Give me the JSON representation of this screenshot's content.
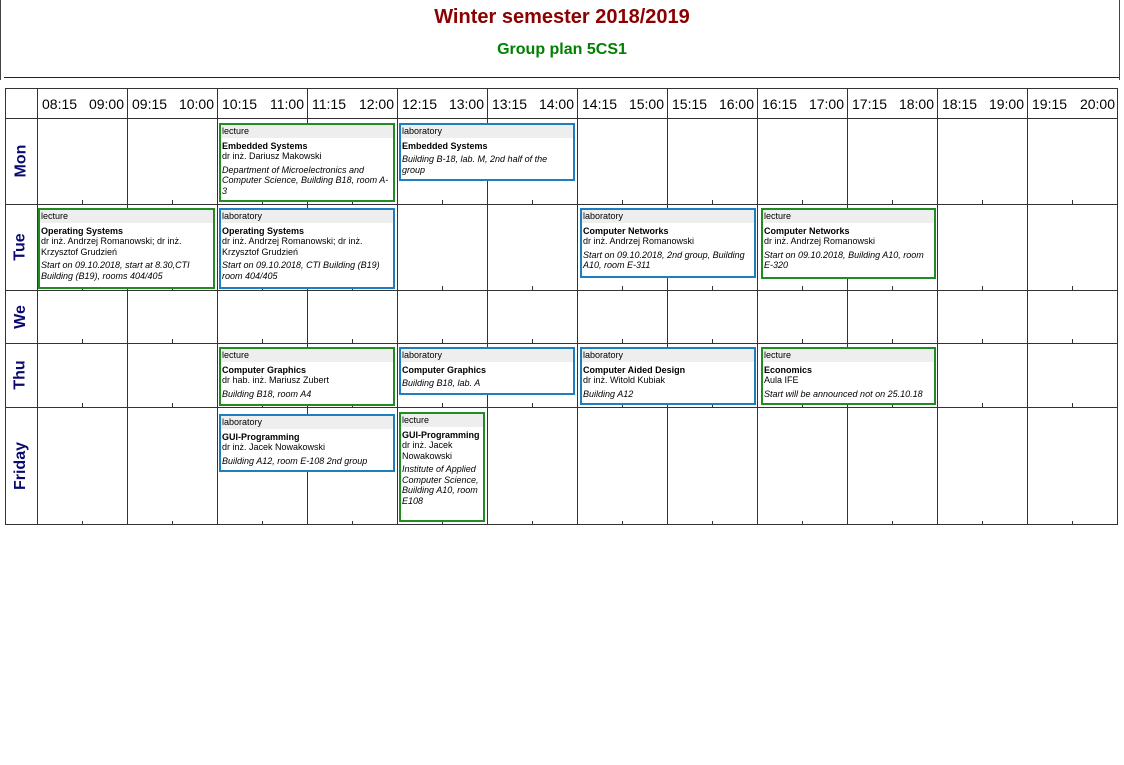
{
  "title": "Winter semester 2018/2019",
  "subtitle": "Group plan 5CS1",
  "time_columns": [
    {
      "start": "08:15",
      "end": "09:00"
    },
    {
      "start": "09:15",
      "end": "10:00"
    },
    {
      "start": "10:15",
      "end": "11:00"
    },
    {
      "start": "11:15",
      "end": "12:00"
    },
    {
      "start": "12:15",
      "end": "13:00"
    },
    {
      "start": "13:15",
      "end": "14:00"
    },
    {
      "start": "14:15",
      "end": "15:00"
    },
    {
      "start": "15:15",
      "end": "16:00"
    },
    {
      "start": "16:15",
      "end": "17:00"
    },
    {
      "start": "17:15",
      "end": "18:00"
    },
    {
      "start": "18:15",
      "end": "19:00"
    },
    {
      "start": "19:15",
      "end": "20:00"
    }
  ],
  "days": [
    "Mon",
    "Tue",
    "We",
    "Thu",
    "Friday"
  ],
  "colors": {
    "title": "#8b0000",
    "subtitle": "#008000",
    "day_label": "#0a0a6e",
    "lecture_border": "#228b22",
    "laboratory_border": "#1e7fc0"
  },
  "events": [
    {
      "type": "lecture",
      "subject": "Embedded Systems",
      "teacher": "dr inż. Dariusz Makowski",
      "info": "Department of Microelectronics and Computer Science, Building B18, room A-3"
    },
    {
      "type": "laboratory",
      "subject": "Embedded Systems",
      "teacher": "",
      "info": "Building B-18, lab. M, 2nd half of the group"
    },
    {
      "type": "lecture",
      "subject": "Operating Systems",
      "teacher": "dr inż. Andrzej Romanowski; dr inż. Krzysztof Grudzień",
      "info": "Start on 09.10.2018, start at 8.30,CTI Building (B19), rooms 404/405"
    },
    {
      "type": "laboratory",
      "subject": "Operating Systems",
      "teacher": "dr inż. Andrzej Romanowski; dr inż. Krzysztof Grudzień",
      "info": "Start on 09.10.2018, CTI Building (B19) room 404/405"
    },
    {
      "type": "laboratory",
      "subject": "Computer Networks",
      "teacher": "dr inż. Andrzej Romanowski",
      "info": "Start on 09.10.2018, 2nd group, Building A10, room E-311"
    },
    {
      "type": "lecture",
      "subject": "Computer Networks",
      "teacher": "dr inż. Andrzej Romanowski",
      "info": "Start on 09.10.2018,  Building A10, room E-320"
    },
    {
      "type": "lecture",
      "subject": "Computer Graphics",
      "teacher": "dr hab. inż. Mariusz Zubert",
      "info": "Building B18, room A4"
    },
    {
      "type": "laboratory",
      "subject": "Computer Graphics",
      "teacher": "",
      "info": "Building B18, lab. A"
    },
    {
      "type": "laboratory",
      "subject": "Computer Aided Design",
      "teacher": "dr inż. Witold Kubiak",
      "info": "Building A12"
    },
    {
      "type": "lecture",
      "subject": "Economics",
      "teacher": "Aula IFE",
      "info": "Start will be announced not on 25.10.18"
    },
    {
      "type": "laboratory",
      "subject": "GUI-Programming",
      "teacher": "dr inż. Jacek Nowakowski",
      "info": "Building A12, room E-108 2nd group"
    },
    {
      "type": "lecture",
      "subject": "GUI-Programming",
      "teacher": "dr inż. Jacek Nowakowski",
      "info": "Institute of Applied Computer Science, Building A10, room E108"
    }
  ]
}
